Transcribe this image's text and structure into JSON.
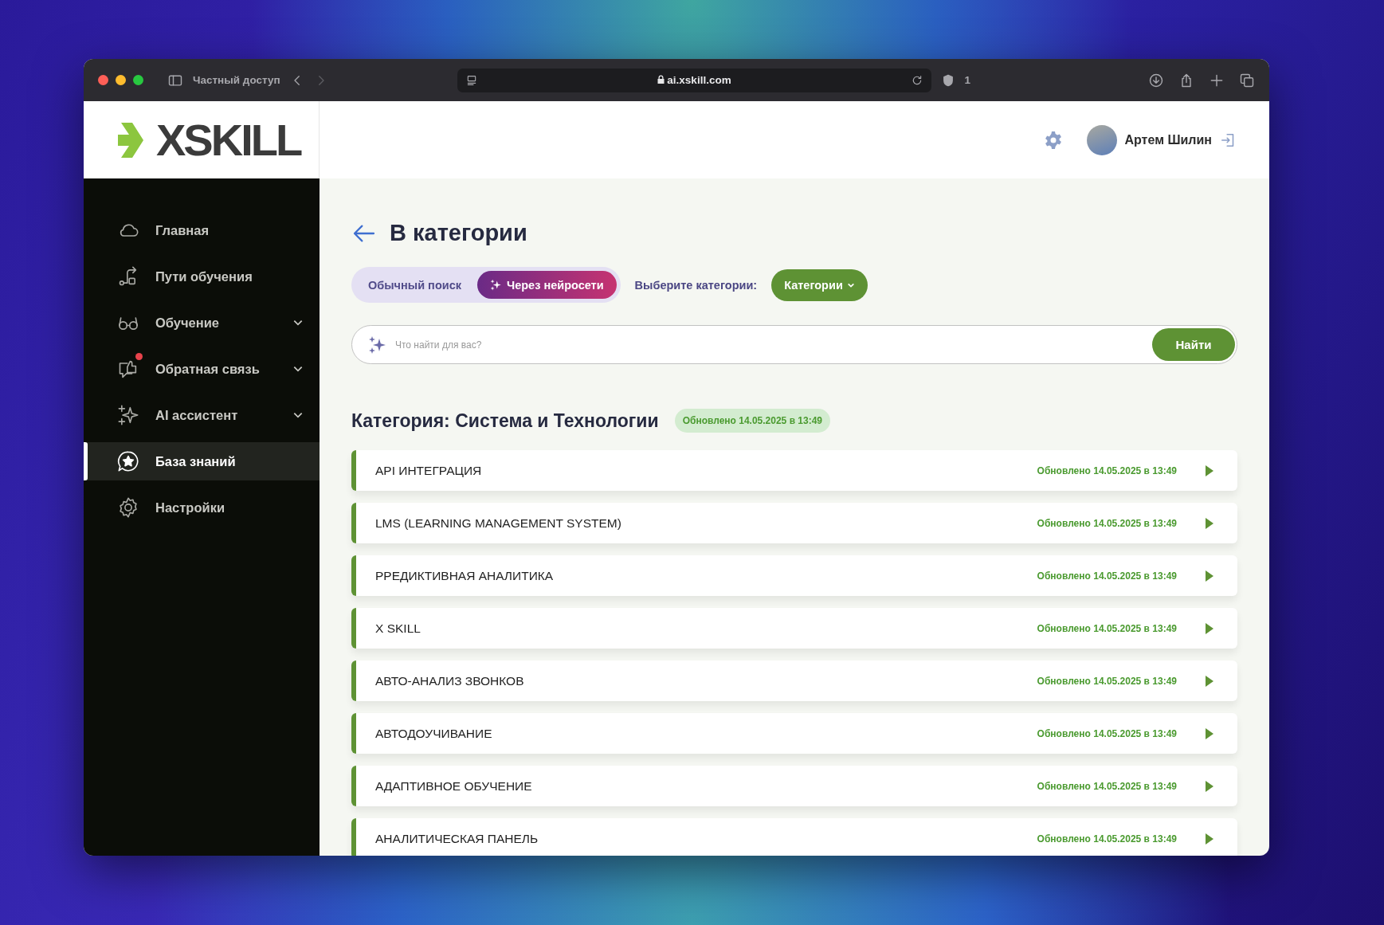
{
  "browser": {
    "tab_label": "Частный доступ",
    "url": "ai.xskill.com",
    "shield_count": "1"
  },
  "logo": "XSKILL",
  "header": {
    "user_name": "Артем Шилин"
  },
  "sidebar": {
    "items": [
      {
        "label": "Главная",
        "expandable": false,
        "notification": false,
        "selected": false
      },
      {
        "label": "Пути обучения",
        "expandable": false,
        "notification": false,
        "selected": false
      },
      {
        "label": "Обучение",
        "expandable": true,
        "notification": false,
        "selected": false
      },
      {
        "label": "Обратная связь",
        "expandable": true,
        "notification": true,
        "selected": false
      },
      {
        "label": "AI ассистент",
        "expandable": true,
        "notification": false,
        "selected": false
      },
      {
        "label": "База знаний",
        "expandable": false,
        "notification": false,
        "selected": true
      },
      {
        "label": "Настройки",
        "expandable": false,
        "notification": false,
        "selected": false
      }
    ]
  },
  "page": {
    "title": "В категории",
    "search_modes": [
      {
        "label": "Обычный поиск",
        "kind": "plain",
        "selected": false
      },
      {
        "label": "Через нейросети",
        "kind": "ai",
        "selected": true
      }
    ],
    "category_prompt": "Выберите категории:",
    "category_button": "Категории",
    "search": {
      "placeholder": "Что найти для вас?",
      "button": "Найти"
    },
    "section": {
      "title": "Категория: Система и Технологии",
      "updated": "Обновлено 14.05.2025 в 13:49"
    },
    "rows": [
      {
        "title": "API ИНТЕГРАЦИЯ",
        "updated": "Обновлено 14.05.2025 в 13:49"
      },
      {
        "title": "LMS (LEARNING MANAGEMENT SYSTEM)",
        "updated": "Обновлено 14.05.2025 в 13:49"
      },
      {
        "title": "РРЕДИКТИВНАЯ АНАЛИТИКА",
        "updated": "Обновлено 14.05.2025 в 13:49"
      },
      {
        "title": "X SKILL",
        "updated": "Обновлено 14.05.2025 в 13:49"
      },
      {
        "title": "АВТО-АНАЛИЗ ЗВОНКОВ",
        "updated": "Обновлено 14.05.2025 в 13:49"
      },
      {
        "title": "АВТОДОУЧИВАНИЕ",
        "updated": "Обновлено 14.05.2025 в 13:49"
      },
      {
        "title": "АДАПТИВНОЕ ОБУЧЕНИЕ",
        "updated": "Обновлено 14.05.2025 в 13:49"
      },
      {
        "title": "АНАЛИТИЧЕСКАЯ ПАНЕЛЬ",
        "updated": "Обновлено 14.05.2025 в 13:49"
      }
    ]
  }
}
